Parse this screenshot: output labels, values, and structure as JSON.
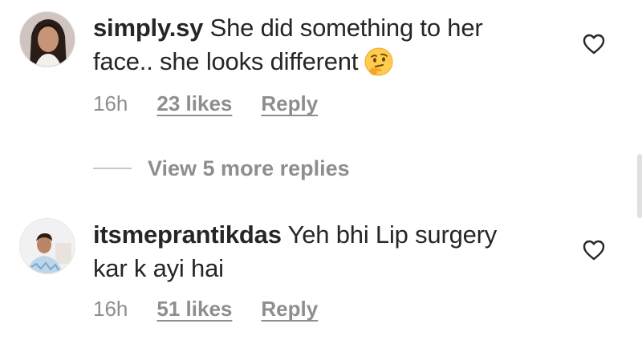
{
  "comments": [
    {
      "username": "simply.sy",
      "text_line1": "She did something to her",
      "text_line2": "face.. she looks different",
      "emoji": "thinking-face",
      "time": "16h",
      "likes": "23 likes",
      "reply": "Reply"
    },
    {
      "username": "itsmeprantikdas",
      "text_line1": "Yeh bhi Lip surgery",
      "text_line2": "kar k ayi hai",
      "time": "16h",
      "likes": "51 likes",
      "reply": "Reply"
    }
  ],
  "view_replies": "View 5 more replies",
  "icons": {
    "like": "heart-outline-icon"
  },
  "colors": {
    "text": "#262626",
    "secondary": "#8e8e8e"
  }
}
